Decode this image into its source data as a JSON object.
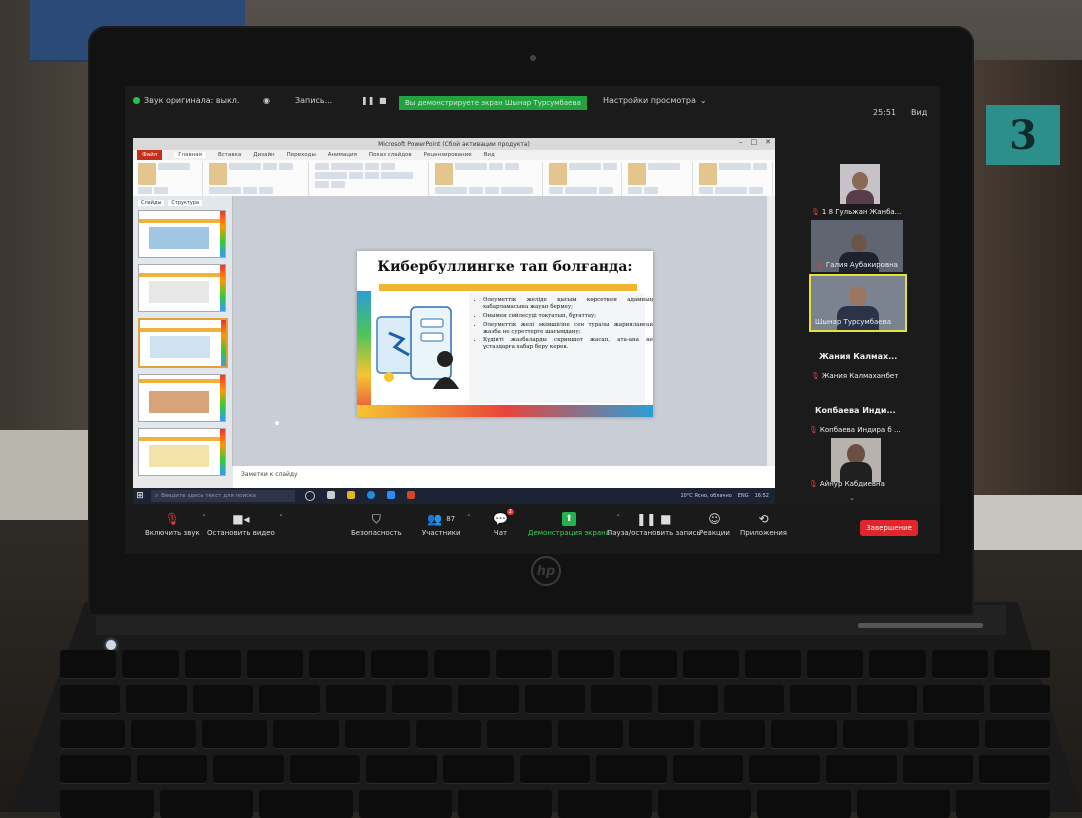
{
  "zoom_top": {
    "audio_status": "Звук оригинала: выкл.",
    "recording": "Запись...",
    "share_banner": "Вы демонстрируете экран Шынар Турсумбаева",
    "view_options": "Настройки просмотра",
    "timer": "25:51",
    "view": "Вид"
  },
  "ppt": {
    "window_title": "Microsoft PowerPoint (Сбой активации продукта)",
    "tabs": [
      "Файл",
      "Главная",
      "Вставка",
      "Дизайн",
      "Переходы",
      "Анимация",
      "Показ слайдов",
      "Рецензирование",
      "Вид"
    ],
    "panel_tabs": [
      "Слайды",
      "Структура"
    ],
    "notes_placeholder": "Заметки к слайду",
    "slide": {
      "title": "Кибербуллингке тап болғанда:",
      "bullets": [
        "Әлеуметтік желіде қысым көрсеткен адамның хабарламасына жауап бермеу;",
        "Онымен сөйлесуді тоқтатып, бұғаттау;",
        "Әлеуметтік желі әкімшісіне сен туралы жарияланған жазба не суреттерге шағымдану;",
        "Күдікті жазбаларды скриншот жасап, ата-ана не ұстаздарға хабар беру керек."
      ]
    }
  },
  "taskbar": {
    "search_placeholder": "Введите здесь текст для поиска",
    "weather": "10°C  Ясно, облачно",
    "lang": "ENG",
    "time": "16:52"
  },
  "participants": {
    "tile1_name": "1 8 Гульжан Жанба...",
    "tile2_name": "Галия Аубакировна",
    "tile3_name": "Шынар Турсумбаева",
    "p4_big": "Жания  Калмах...",
    "p4_name": "Жания Калмаханбет",
    "p5_big": "Копбаева  Инди...",
    "p5_name": "Копбаева Индира б ...",
    "tile6_name": "Айнур Кабдиевна"
  },
  "controls": {
    "unmute": "Включить звук",
    "video": "Остановить видео",
    "security": "Безопасность",
    "participants": "Участники",
    "participants_count": "87",
    "chat": "Чат",
    "chat_badge": "2",
    "share": "Демонстрация экрана",
    "record": "Пауза/остановить запись",
    "reactions": "Реакции",
    "apps": "Приложения",
    "end": "Завершение"
  },
  "room": {
    "door_number": "3"
  }
}
